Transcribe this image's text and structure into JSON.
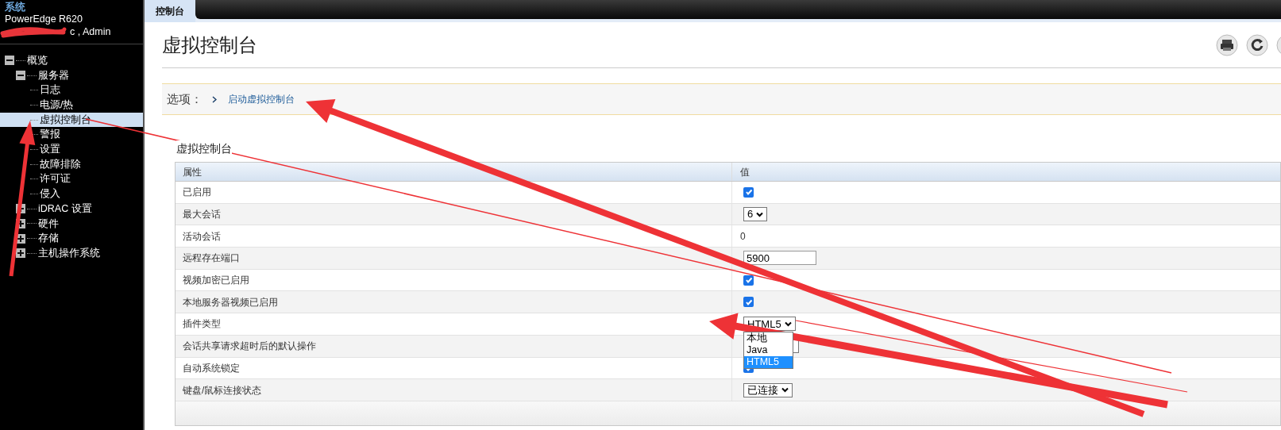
{
  "sidebar": {
    "header": {
      "title": "系统",
      "model": "PowerEdge R620",
      "user": "c , Admin"
    },
    "tree": [
      {
        "label": "概览",
        "expanded": true,
        "selected": false,
        "children": [
          {
            "label": "服务器",
            "expanded": true,
            "selected": false,
            "children": [
              {
                "label": "日志",
                "selected": false
              },
              {
                "label": "电源/热",
                "selected": false
              },
              {
                "label": "虚拟控制台",
                "selected": true
              },
              {
                "label": "警报",
                "selected": false
              },
              {
                "label": "设置",
                "selected": false
              },
              {
                "label": "故障排除",
                "selected": false
              },
              {
                "label": "许可证",
                "selected": false
              },
              {
                "label": "侵入",
                "selected": false
              }
            ]
          },
          {
            "label": "iDRAC 设置",
            "expanded": false,
            "selected": false
          },
          {
            "label": "硬件",
            "expanded": false,
            "selected": false
          },
          {
            "label": "存储",
            "expanded": false,
            "selected": false
          },
          {
            "label": "主机操作系统",
            "expanded": false,
            "selected": false
          }
        ]
      }
    ]
  },
  "tabs": [
    {
      "label": "控制台",
      "selected": true
    }
  ],
  "page_title": "虚拟控制台",
  "options": {
    "label": "选项：",
    "links": [
      "启动虚拟控制台"
    ]
  },
  "section_title": "虚拟控制台",
  "table": {
    "columns": [
      "属性",
      "值"
    ],
    "rows": [
      {
        "property": "已启用",
        "kind": "checkbox",
        "checked": true
      },
      {
        "property": "最大会话",
        "kind": "select",
        "value": "6"
      },
      {
        "property": "活动会话",
        "kind": "text",
        "value": "0"
      },
      {
        "property": "远程存在端口",
        "kind": "input",
        "value": "5900"
      },
      {
        "property": "视频加密已启用",
        "kind": "checkbox",
        "checked": true
      },
      {
        "property": "本地服务器视频已启用",
        "kind": "checkbox",
        "checked": true
      },
      {
        "property": "插件类型",
        "kind": "dropdown",
        "value": "HTML5",
        "options": [
          {
            "label": "本地",
            "selected": false
          },
          {
            "label": "Java",
            "selected": false
          },
          {
            "label": "HTML5",
            "selected": true
          }
        ]
      },
      {
        "property": "会话共享请求超时后的默认操作",
        "kind": "covered_select"
      },
      {
        "property": "自动系统锁定",
        "kind": "checkbox",
        "checked": true
      },
      {
        "property": "键盘/鼠标连接状态",
        "kind": "select",
        "value": "已连接"
      }
    ]
  }
}
